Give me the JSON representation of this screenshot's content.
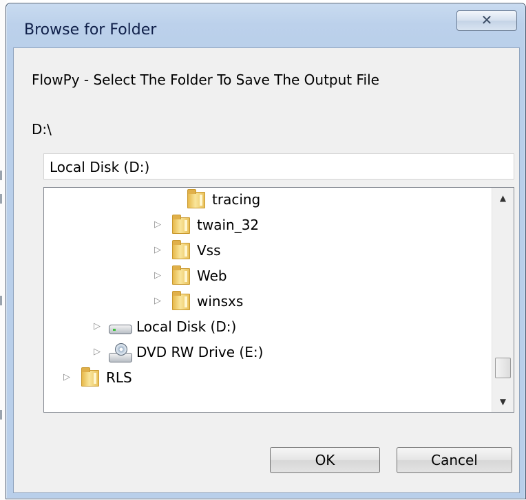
{
  "window": {
    "title": "Browse for Folder",
    "close_glyph": "✕"
  },
  "dialog": {
    "prompt": "FlowPy - Select The Folder To Save The Output File",
    "current_path": "D:\\",
    "folder_field_value": "Local Disk (D:)"
  },
  "tree": {
    "items": [
      {
        "label": "tracing",
        "icon": "folder-icon",
        "expander": false
      },
      {
        "label": "twain_32",
        "icon": "folder-icon",
        "expander": true
      },
      {
        "label": "Vss",
        "icon": "folder-icon",
        "expander": true
      },
      {
        "label": "Web",
        "icon": "folder-icon",
        "expander": true
      },
      {
        "label": "winsxs",
        "icon": "folder-icon",
        "expander": true
      },
      {
        "label": "Local Disk (D:)",
        "icon": "hard-disk-icon",
        "expander": true
      },
      {
        "label": "DVD RW Drive (E:)",
        "icon": "dvd-drive-icon",
        "expander": true
      },
      {
        "label": "RLS",
        "icon": "folder-icon",
        "expander": true
      }
    ],
    "expander_glyph": "▷",
    "scroll_up_glyph": "▲",
    "scroll_down_glyph": "▼"
  },
  "buttons": {
    "ok": "OK",
    "cancel": "Cancel"
  }
}
